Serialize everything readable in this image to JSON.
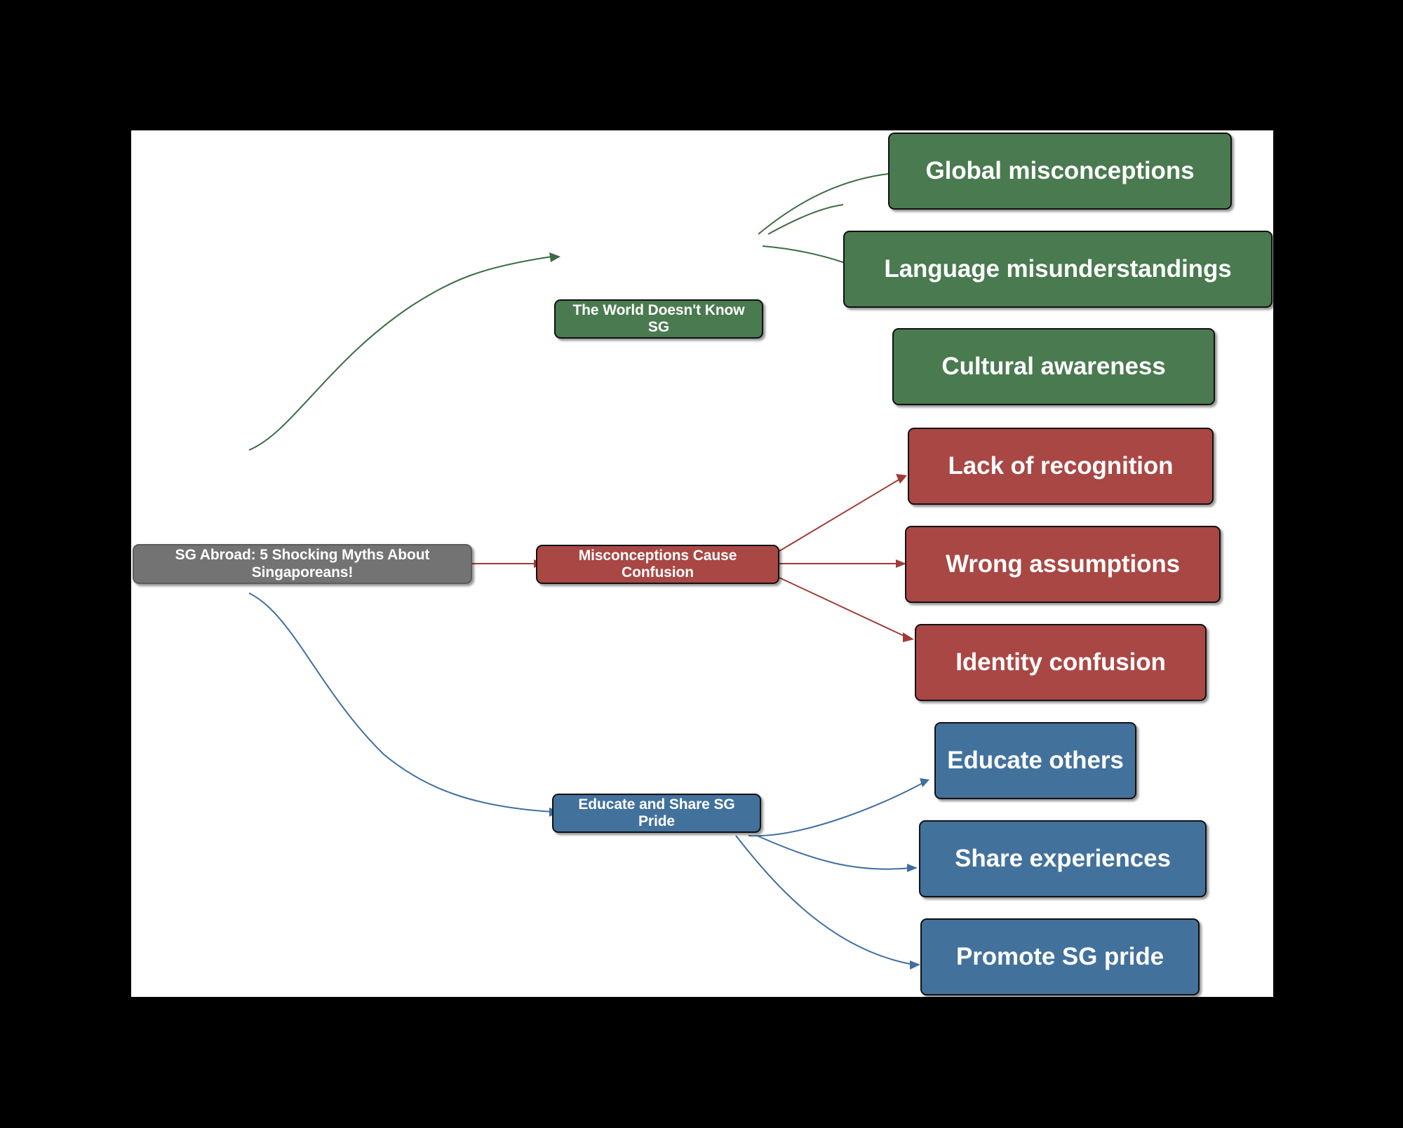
{
  "diagram": {
    "type": "mindmap",
    "title": "SG Abroad: 5 Shocking Myths About Singaporeans!",
    "background": "#000000",
    "canvas_background": "#ffffff",
    "colors": {
      "root": "#737373",
      "green": "#4a7a4f",
      "red": "#a94744",
      "blue": "#42719c",
      "text": "#ffffff",
      "border": "#111111"
    },
    "root": {
      "label": "SG Abroad: 5 Shocking Myths About Singaporeans!"
    },
    "branches": [
      {
        "id": "branch-world",
        "label": "The World Doesn't Know SG",
        "color": "green",
        "children": [
          {
            "id": "leaf-global-misconceptions",
            "label": "Global misconceptions"
          },
          {
            "id": "leaf-language-misunderstandings",
            "label": "Language misunderstandings"
          },
          {
            "id": "leaf-cultural-awareness",
            "label": "Cultural awareness"
          }
        ]
      },
      {
        "id": "branch-misconceptions",
        "label": "Misconceptions Cause Confusion",
        "color": "red",
        "children": [
          {
            "id": "leaf-lack-of-recognition",
            "label": "Lack of recognition"
          },
          {
            "id": "leaf-wrong-assumptions",
            "label": "Wrong assumptions"
          },
          {
            "id": "leaf-identity-confusion",
            "label": "Identity confusion"
          }
        ]
      },
      {
        "id": "branch-educate",
        "label": "Educate and Share SG Pride",
        "color": "blue",
        "children": [
          {
            "id": "leaf-educate-others",
            "label": "Educate others"
          },
          {
            "id": "leaf-share-experiences",
            "label": "Share experiences"
          },
          {
            "id": "leaf-promote-sg-pride",
            "label": "Promote SG pride"
          }
        ]
      }
    ]
  }
}
